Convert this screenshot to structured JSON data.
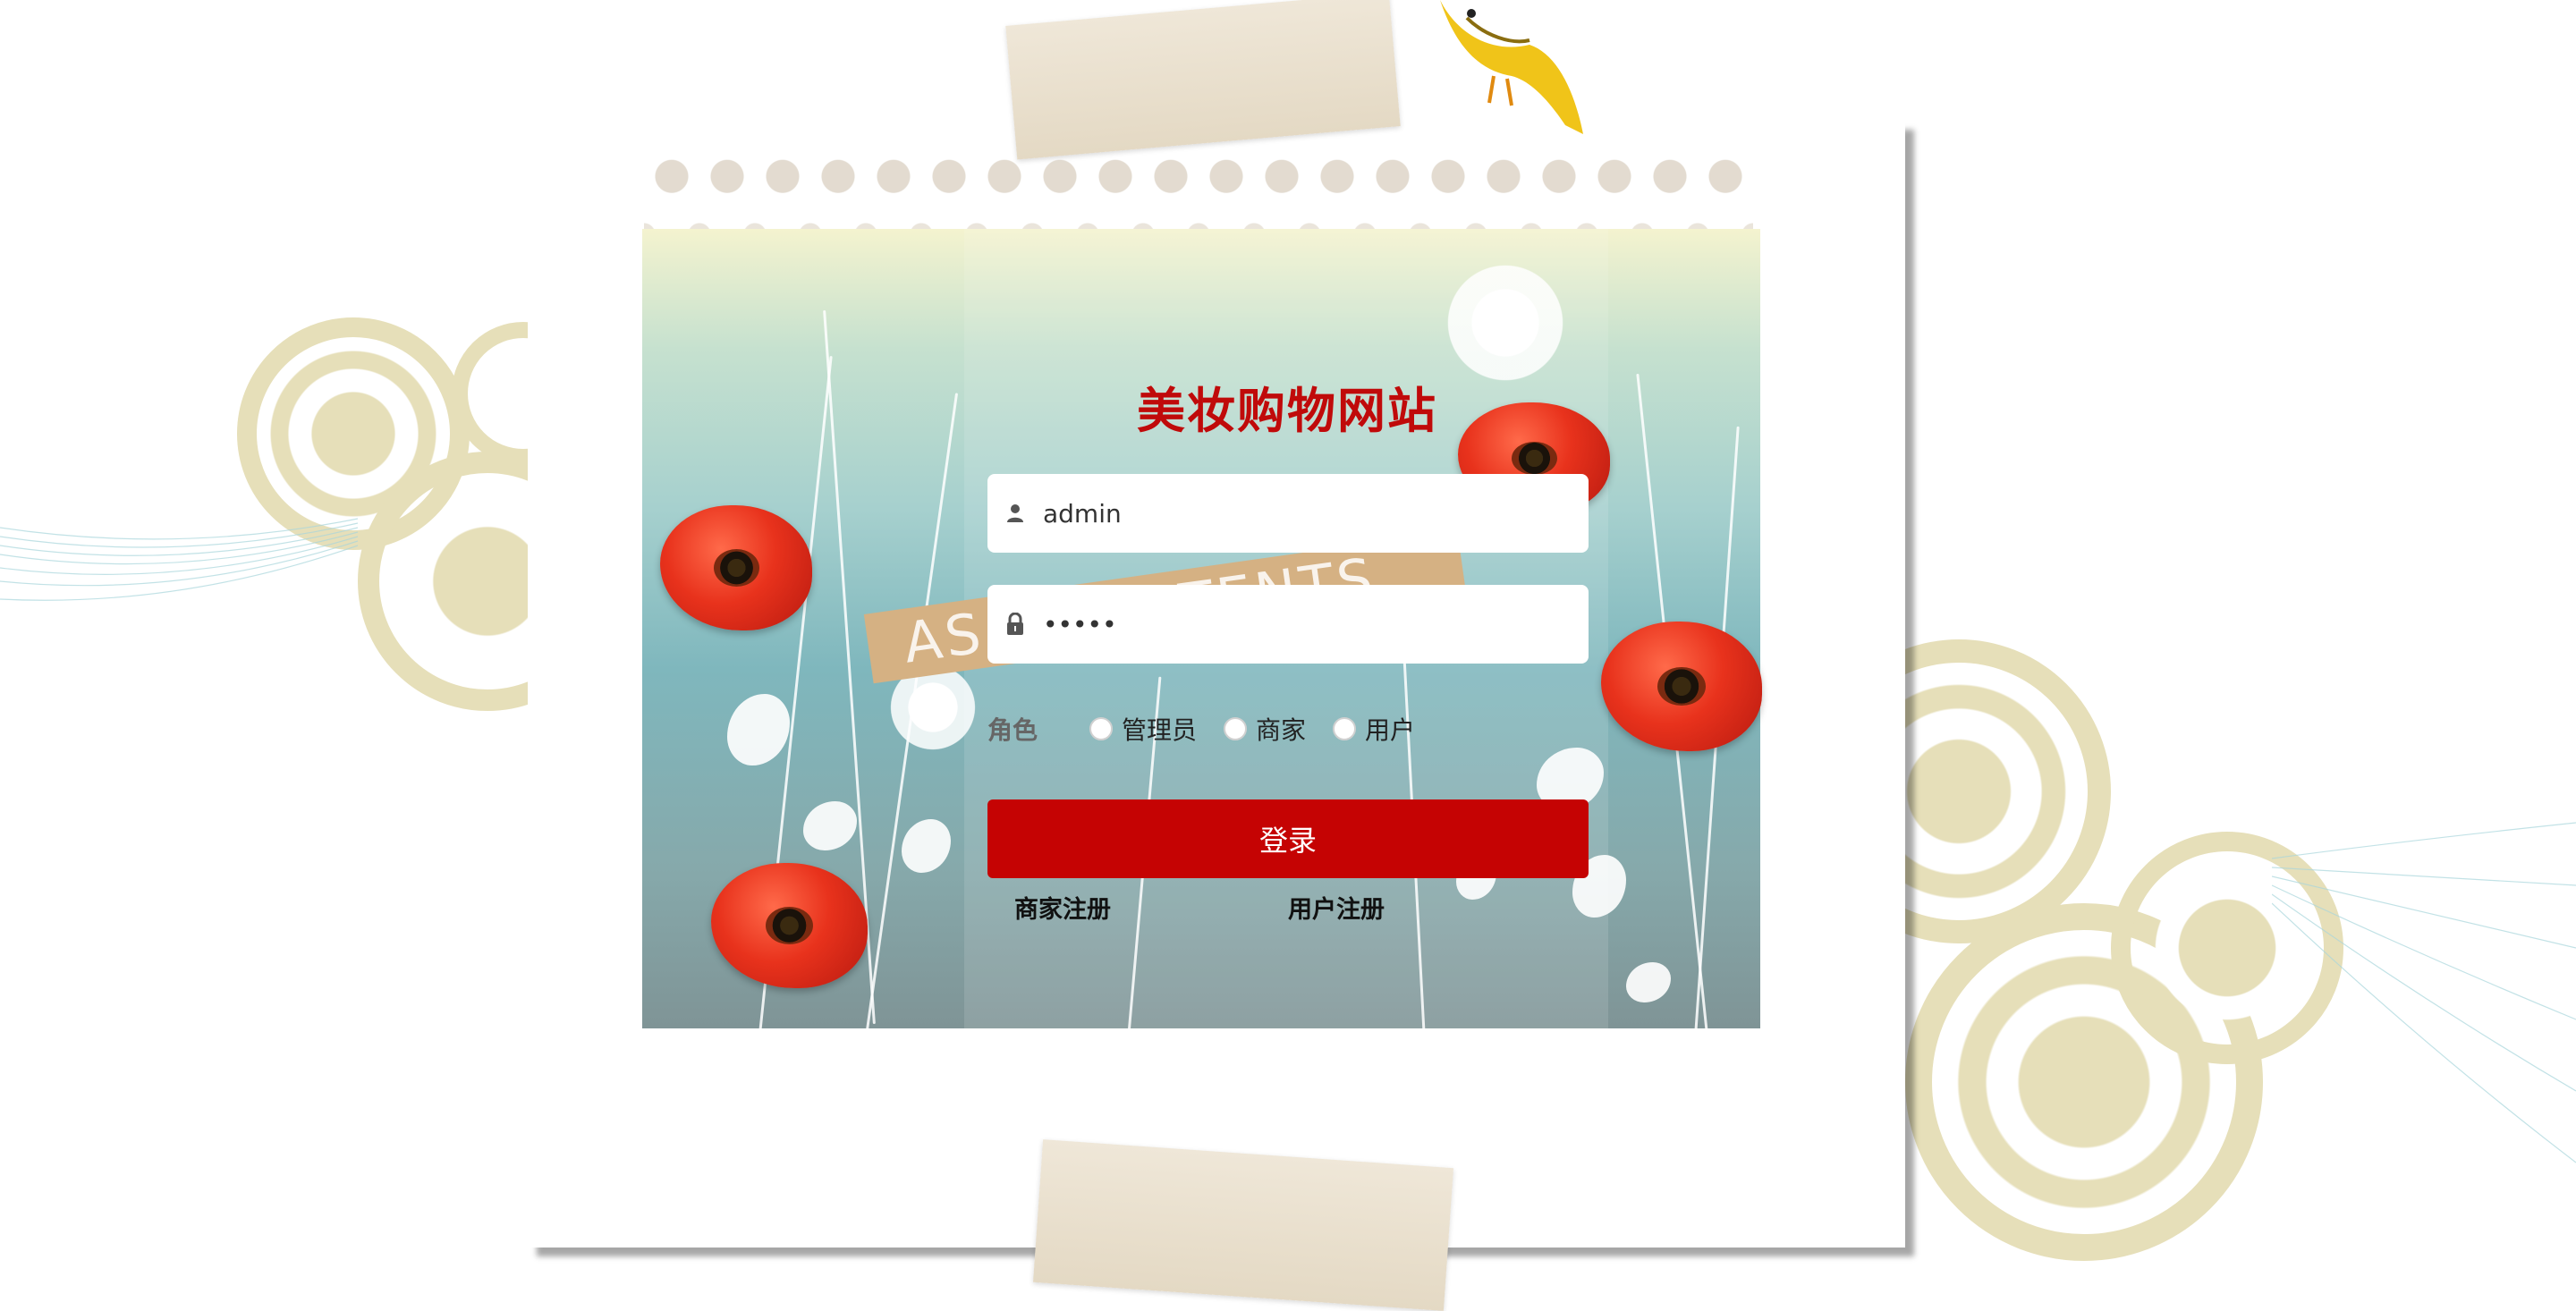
{
  "site": {
    "title": "美妆购物网站"
  },
  "decor": {
    "banner_text": "ASA CONTENTS"
  },
  "login": {
    "username": {
      "value": "admin",
      "icon": "user-icon"
    },
    "password": {
      "value": "•••••",
      "icon": "lock-icon"
    },
    "role": {
      "label": "角色",
      "options": [
        "管理员",
        "商家",
        "用户"
      ]
    },
    "submit_label": "登录",
    "links": {
      "merchant_register": "商家注册",
      "user_register": "用户注册"
    }
  },
  "colors": {
    "accent": "#c50303",
    "title": "#c00a0a"
  }
}
